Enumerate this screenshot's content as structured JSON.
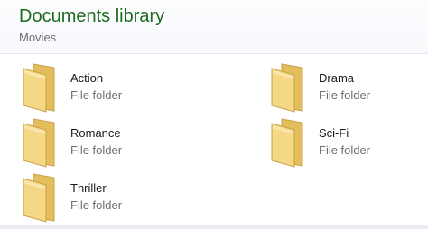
{
  "library": {
    "title": "Documents library",
    "subtitle": "Movies"
  },
  "icon": "folder-icon",
  "folders": [
    {
      "name": "Action",
      "type": "File folder"
    },
    {
      "name": "Drama",
      "type": "File folder"
    },
    {
      "name": "Romance",
      "type": "File folder"
    },
    {
      "name": "Sci-Fi",
      "type": "File folder"
    },
    {
      "name": "Thriller",
      "type": "File folder"
    }
  ],
  "colors": {
    "title": "#1e6a1e",
    "folder_front": "#f4d885",
    "folder_back": "#e4bd5c"
  }
}
